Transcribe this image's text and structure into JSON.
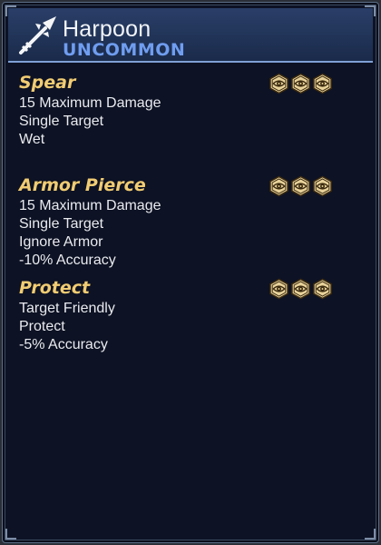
{
  "item": {
    "name": "Harpoon",
    "rarity": "UNCOMMON",
    "icon": "harpoon-icon"
  },
  "colors": {
    "ability_name": "#f1cc72",
    "rarity": "#6f9df0",
    "cost_icon_fill": "#e8d29a",
    "cost_icon_stroke": "#3a2a10"
  },
  "abilities": [
    {
      "name": "Spear",
      "cost_icons": [
        "eye-token-icon",
        "eye-token-icon",
        "eye-token-icon"
      ],
      "lines": [
        "15 Maximum Damage",
        "Single Target",
        "Wet"
      ]
    },
    {
      "name": "Armor Pierce",
      "cost_icons": [
        "eye-token-icon",
        "eye-token-icon",
        "eye-token-icon"
      ],
      "lines": [
        "15 Maximum Damage",
        "Single Target",
        "Ignore Armor",
        "-10% Accuracy"
      ]
    },
    {
      "name": "Protect",
      "cost_icons": [
        "eye-token-icon",
        "eye-token-icon",
        "eye-token-icon"
      ],
      "lines": [
        "Target Friendly",
        "Protect",
        "-5% Accuracy"
      ]
    }
  ]
}
